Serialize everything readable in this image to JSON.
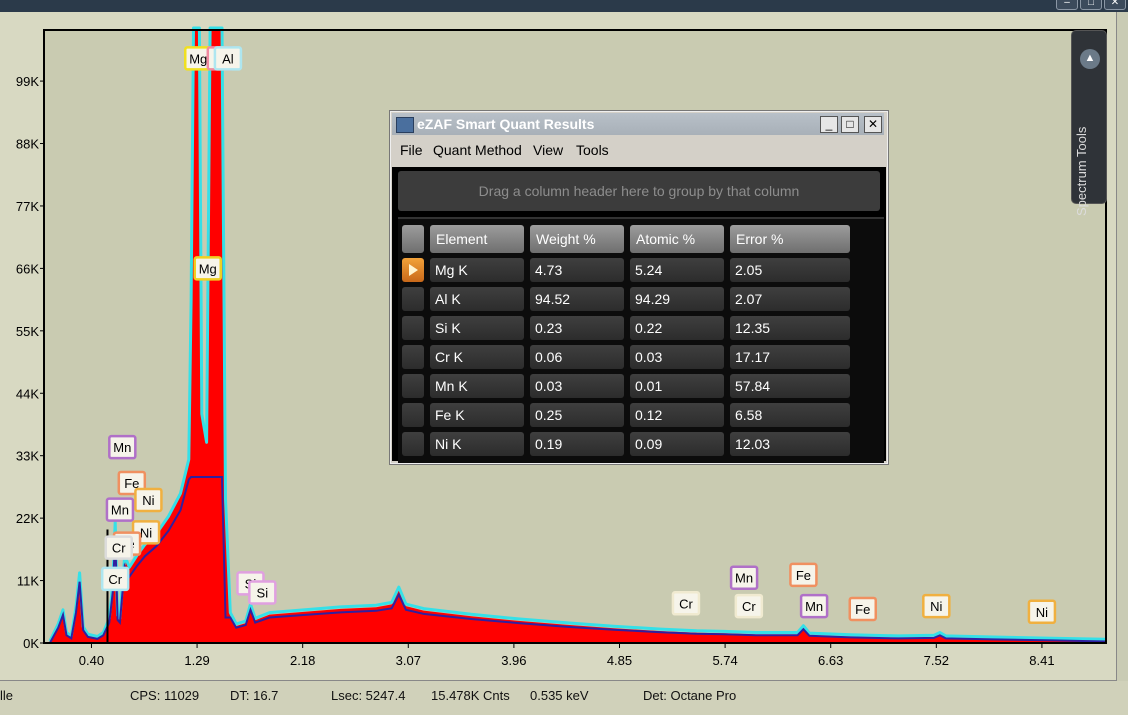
{
  "chart_data": {
    "type": "area",
    "title": "",
    "xlabel": "",
    "ylabel": "",
    "x_ticks": [
      "0.40",
      "1.29",
      "2.18",
      "3.07",
      "3.96",
      "4.85",
      "5.74",
      "6.63",
      "7.52",
      "8.41"
    ],
    "y_ticks": [
      "0K",
      "11K",
      "22K",
      "33K",
      "44K",
      "55K",
      "66K",
      "77K",
      "88K",
      "99K"
    ],
    "xlim": [
      0.0,
      8.95
    ],
    "ylim": [
      0,
      108000
    ],
    "x_scale_step": 0.89,
    "series": [
      {
        "points": [
          [
            0.05,
            0
          ],
          [
            0.12,
            3000
          ],
          [
            0.16,
            5500
          ],
          [
            0.19,
            1500
          ],
          [
            0.23,
            900
          ],
          [
            0.27,
            6000
          ],
          [
            0.3,
            12000
          ],
          [
            0.33,
            2500
          ],
          [
            0.37,
            1200
          ],
          [
            0.45,
            800
          ],
          [
            0.5,
            1500
          ],
          [
            0.55,
            4000
          ],
          [
            0.58,
            10000
          ],
          [
            0.6,
            21000
          ],
          [
            0.62,
            4500
          ],
          [
            0.64,
            4000
          ],
          [
            0.68,
            15000
          ],
          [
            0.72,
            13000
          ],
          [
            0.78,
            15000
          ],
          [
            0.85,
            17000
          ],
          [
            0.95,
            19000
          ],
          [
            1.05,
            22000
          ],
          [
            1.15,
            26000
          ],
          [
            1.22,
            32000
          ],
          [
            1.24,
            60000
          ],
          [
            1.26,
            108000
          ],
          [
            1.31,
            108000
          ],
          [
            1.33,
            40000
          ],
          [
            1.37,
            35000
          ],
          [
            1.4,
            108000
          ],
          [
            1.5,
            108000
          ],
          [
            1.53,
            25000
          ],
          [
            1.57,
            5000
          ],
          [
            1.62,
            3000
          ],
          [
            1.7,
            3500
          ],
          [
            1.74,
            6500
          ],
          [
            1.78,
            4000
          ],
          [
            1.9,
            5000
          ],
          [
            2.2,
            5500
          ],
          [
            2.5,
            6000
          ],
          [
            2.8,
            6300
          ],
          [
            2.93,
            6800
          ],
          [
            2.99,
            9500
          ],
          [
            3.05,
            6500
          ],
          [
            3.2,
            5700
          ],
          [
            3.6,
            4700
          ],
          [
            4.0,
            3900
          ],
          [
            4.4,
            3200
          ],
          [
            4.8,
            2600
          ],
          [
            5.2,
            2100
          ],
          [
            5.5,
            1800
          ],
          [
            5.74,
            1700
          ],
          [
            6.0,
            1500
          ],
          [
            6.35,
            1500
          ],
          [
            6.4,
            2700
          ],
          [
            6.45,
            1400
          ],
          [
            6.8,
            1100
          ],
          [
            7.2,
            900
          ],
          [
            7.5,
            1000
          ],
          [
            7.55,
            1500
          ],
          [
            7.6,
            900
          ],
          [
            8.0,
            700
          ],
          [
            8.5,
            500
          ],
          [
            8.95,
            300
          ]
        ]
      }
    ],
    "peak_labels": [
      {
        "text": "Mg",
        "x": 1.3,
        "y": 103000,
        "color": "#f0e020"
      },
      {
        "text": "Al",
        "x": 1.49,
        "y": 103000,
        "color": "#f08aa0"
      },
      {
        "text": "Al",
        "x": 1.55,
        "y": 103000,
        "color": "#aee6f0"
      },
      {
        "text": "Mg",
        "x": 1.38,
        "y": 66000,
        "color": "#f0d020"
      },
      {
        "text": "Mn",
        "x": 0.66,
        "y": 34500,
        "color": "#b070c8"
      },
      {
        "text": "Fe",
        "x": 0.74,
        "y": 28200,
        "color": "#f09060"
      },
      {
        "text": "Ni",
        "x": 0.88,
        "y": 25200,
        "color": "#f0b040"
      },
      {
        "text": "Mn",
        "x": 0.64,
        "y": 23500,
        "color": "#b070c8"
      },
      {
        "text": "Ni",
        "x": 0.86,
        "y": 19500,
        "color": "#f0b040"
      },
      {
        "text": "Fe",
        "x": 0.7,
        "y": 17500,
        "color": "#f09060"
      },
      {
        "text": "Cr",
        "x": 0.63,
        "y": 16800,
        "color": "#dcdcdc"
      },
      {
        "text": "Cr",
        "x": 0.6,
        "y": 11300,
        "color": "#aee6f0"
      },
      {
        "text": "Si",
        "x": 1.74,
        "y": 10500,
        "color": "#e0a0e0"
      },
      {
        "text": "Si",
        "x": 1.84,
        "y": 8900,
        "color": "#e0a0e0"
      },
      {
        "text": "Cr",
        "x": 5.41,
        "y": 7000,
        "color": "#f0ead0"
      },
      {
        "text": "Cr",
        "x": 5.94,
        "y": 6500,
        "color": "#f0ead0"
      },
      {
        "text": "Mn",
        "x": 5.9,
        "y": 11500,
        "color": "#b070c8"
      },
      {
        "text": "Mn",
        "x": 6.49,
        "y": 6500,
        "color": "#b070c8"
      },
      {
        "text": "Fe",
        "x": 6.4,
        "y": 12000,
        "color": "#f09060"
      },
      {
        "text": "Fe",
        "x": 6.9,
        "y": 6000,
        "color": "#f09060"
      },
      {
        "text": "Ni",
        "x": 7.52,
        "y": 6500,
        "color": "#f0b040"
      },
      {
        "text": "Ni",
        "x": 8.41,
        "y": 5500,
        "color": "#f0b040"
      }
    ]
  },
  "side_panel": {
    "label": "Spectrum Tools"
  },
  "window_buttons": [
    "–",
    "□",
    "✕"
  ],
  "status_bar": {
    "left": "lle",
    "cps": "CPS: 11029",
    "dt": "DT: 16.7",
    "lsec": "Lsec: 5247.4",
    "counts": "15.478K Cnts",
    "kev": "0.535 keV",
    "det": "Det: Octane Pro"
  },
  "dialog": {
    "title": "eZAF Smart Quant Results",
    "buttons": [
      "_",
      "□",
      "✕"
    ],
    "menu": [
      "File",
      "Quant Method",
      "View",
      "Tools"
    ],
    "group_hint": "Drag a column header here to group by that column",
    "columns": [
      "Element",
      "Weight %",
      "Atomic %",
      "Error %"
    ],
    "rows": [
      {
        "element": "Mg K",
        "weight": "4.73",
        "atomic": "5.24",
        "error": "2.05",
        "selected": true
      },
      {
        "element": "Al K",
        "weight": "94.52",
        "atomic": "94.29",
        "error": "2.07",
        "selected": false
      },
      {
        "element": "Si K",
        "weight": "0.23",
        "atomic": "0.22",
        "error": "12.35",
        "selected": false
      },
      {
        "element": "Cr K",
        "weight": "0.06",
        "atomic": "0.03",
        "error": "17.17",
        "selected": false
      },
      {
        "element": "Mn K",
        "weight": "0.03",
        "atomic": "0.01",
        "error": "57.84",
        "selected": false
      },
      {
        "element": "Fe K",
        "weight": "0.25",
        "atomic": "0.12",
        "error": "6.58",
        "selected": false
      },
      {
        "element": "Ni K",
        "weight": "0.19",
        "atomic": "0.09",
        "error": "12.03",
        "selected": false
      }
    ]
  }
}
